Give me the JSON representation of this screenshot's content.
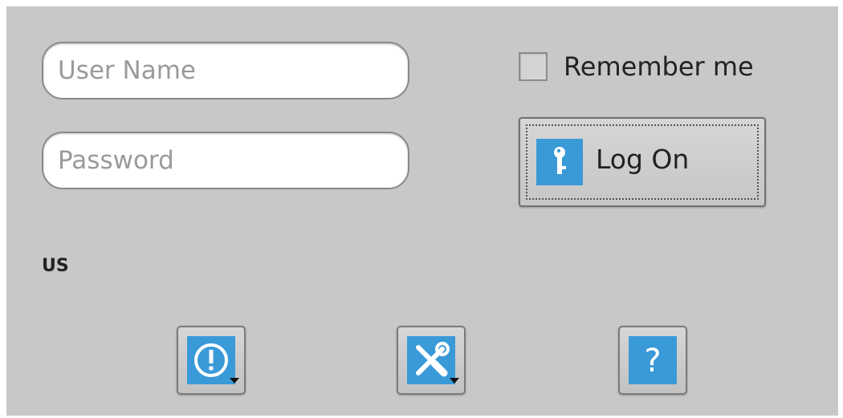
{
  "login": {
    "username_placeholder": "User Name",
    "password_placeholder": "Password",
    "remember_label": "Remember me",
    "remember_checked": false,
    "logon_label": "Log On"
  },
  "locale": "US",
  "toolbar": {
    "power_icon": "power-icon",
    "tools_icon": "tools-icon",
    "help_icon": "help-icon",
    "help_glyph": "?"
  },
  "colors": {
    "panel": "#c8c8c8",
    "icon_tile": "#3a9ad8"
  }
}
